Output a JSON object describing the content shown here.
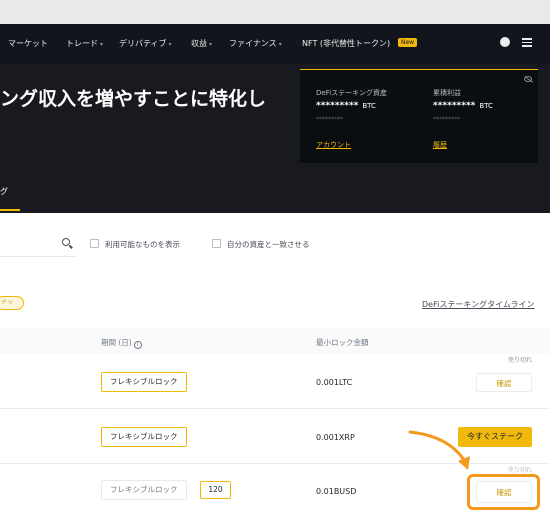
{
  "nav": {
    "items": [
      {
        "label": "マーケット",
        "caret": false
      },
      {
        "label": "トレード",
        "caret": true
      },
      {
        "label": "デリバティブ",
        "caret": true
      },
      {
        "label": "収益",
        "caret": true
      },
      {
        "label": "ファイナンス",
        "caret": true
      },
      {
        "label": "NFT (非代替性トークン)",
        "caret": false
      }
    ],
    "new_badge": "New"
  },
  "hero": {
    "title": "ング収入を増やすことに特化し",
    "assets": {
      "defi_label": "DeFiステーキング資産",
      "defi_value": "*********",
      "defi_unit": "BTC",
      "defi_sub": "*********",
      "defi_link": "アカウント",
      "cum_label": "累積利益",
      "cum_value": "*********",
      "cum_unit": "BTC",
      "cum_sub": "*********",
      "cum_link": "履歴"
    }
  },
  "tabs": {
    "active": "グ"
  },
  "filters": {
    "available_only": "利用可能なものを表示",
    "match_assets": "自分の資産と一致させる"
  },
  "pill": "ドッ",
  "timeline_link": "DeFiステーキングタイムライン",
  "table": {
    "headers": {
      "duration": "期間 (日)",
      "min_lock": "最小ロック金額"
    },
    "rows": [
      {
        "lock": "フレキシブルロック",
        "min": "0.001LTC",
        "status": "売り切れ",
        "action": "確認"
      },
      {
        "lock": "フレキシブルロック",
        "min": "0.001XRP",
        "action": "今すぐステーク"
      },
      {
        "lock": "フレキシブルロック",
        "days": "120",
        "min": "0.01BUSD",
        "status": "売り切れ",
        "action": "確認"
      }
    ]
  },
  "colors": {
    "accent": "#f0b90b",
    "highlight": "#f29a1d",
    "dark": "#12161c"
  }
}
